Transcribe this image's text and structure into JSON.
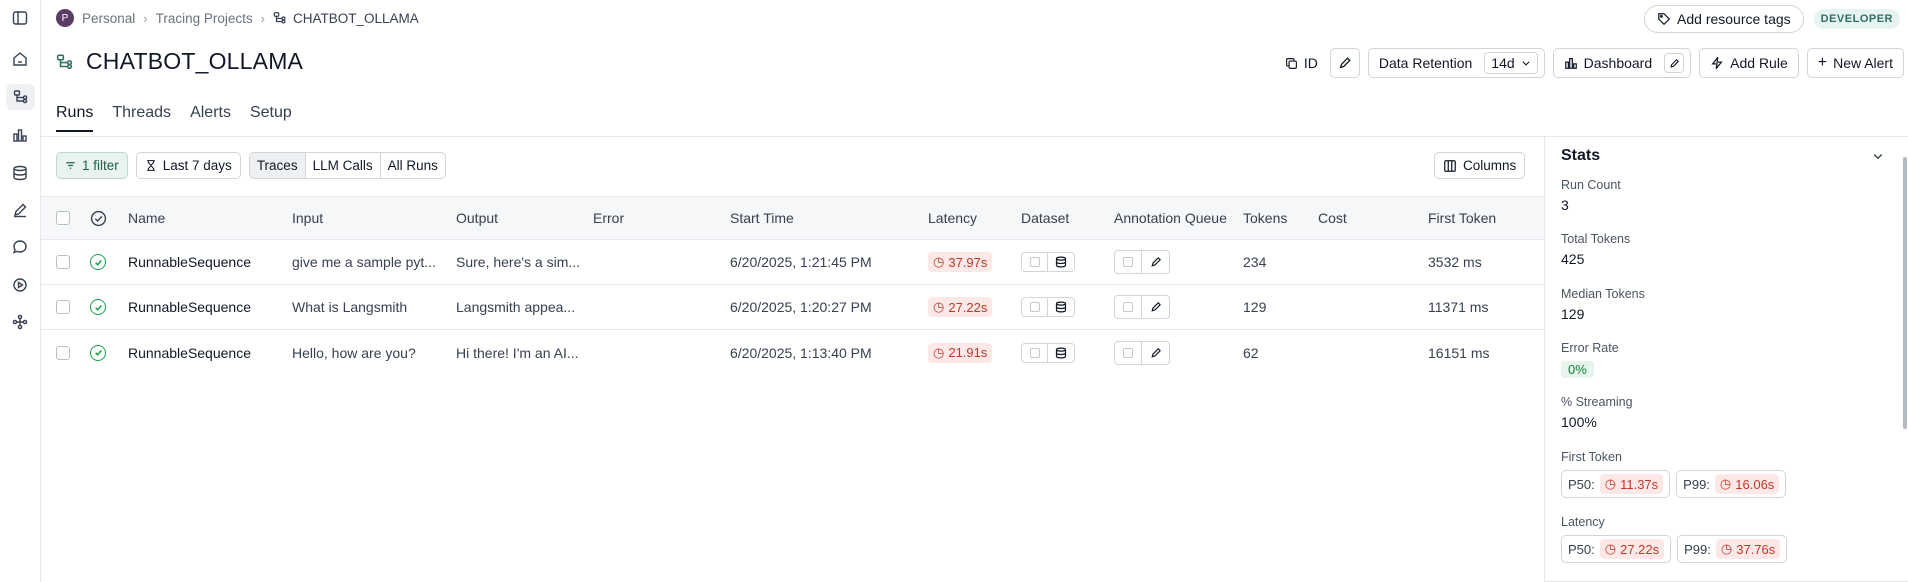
{
  "breadcrumb": {
    "avatar_initial": "P",
    "personal": "Personal",
    "projects": "Tracing Projects",
    "current": "CHATBOT_OLLAMA"
  },
  "top": {
    "resource_tags": "Add resource tags",
    "badge": "DEVELOPER"
  },
  "project": {
    "title": "CHATBOT_OLLAMA",
    "id_label": "ID",
    "data_retention_label": "Data Retention",
    "data_retention_value": "14d",
    "dashboard_label": "Dashboard",
    "add_rule_label": "Add Rule",
    "new_alert_label": "New Alert"
  },
  "tabs": [
    "Runs",
    "Threads",
    "Alerts",
    "Setup"
  ],
  "filters": {
    "filter_label": "1 filter",
    "time_label": "Last 7 days",
    "segments": [
      "Traces",
      "LLM Calls",
      "All Runs"
    ],
    "columns_label": "Columns"
  },
  "table": {
    "headers": {
      "name": "Name",
      "input": "Input",
      "output": "Output",
      "error": "Error",
      "start_time": "Start Time",
      "latency": "Latency",
      "dataset": "Dataset",
      "annotation_queue": "Annotation Queue",
      "tokens": "Tokens",
      "cost": "Cost",
      "first_token": "First Token"
    },
    "rows": [
      {
        "name": "RunnableSequence",
        "input": "give me a sample pyt...",
        "output": "Sure, here's a sim...",
        "error": "",
        "start_time": "6/20/2025, 1:21:45 PM",
        "latency": "37.97s",
        "tokens": "234",
        "cost": "",
        "first_token": "3532 ms"
      },
      {
        "name": "RunnableSequence",
        "input": "What is Langsmith",
        "output": "Langsmith appea...",
        "error": "",
        "start_time": "6/20/2025, 1:20:27 PM",
        "latency": "27.22s",
        "tokens": "129",
        "cost": "",
        "first_token": "11371 ms"
      },
      {
        "name": "RunnableSequence",
        "input": "Hello, how are you?",
        "output": "Hi there! I'm an AI...",
        "error": "",
        "start_time": "6/20/2025, 1:13:40 PM",
        "latency": "21.91s",
        "tokens": "62",
        "cost": "",
        "first_token": "16151 ms"
      }
    ]
  },
  "stats": {
    "title": "Stats",
    "run_count_label": "Run Count",
    "run_count": "3",
    "total_tokens_label": "Total Tokens",
    "total_tokens": "425",
    "median_tokens_label": "Median Tokens",
    "median_tokens": "129",
    "error_rate_label": "Error Rate",
    "error_rate": "0%",
    "streaming_label": "% Streaming",
    "streaming": "100%",
    "first_token_label": "First Token",
    "first_token_p50_label": "P50:",
    "first_token_p50": "11.37s",
    "first_token_p99_label": "P99:",
    "first_token_p99": "16.06s",
    "latency_label": "Latency",
    "latency_p50_label": "P50:",
    "latency_p50": "27.22s",
    "latency_p99_label": "P99:",
    "latency_p99": "37.76s"
  },
  "colors": {
    "latency_bg": "#fde8e8",
    "latency_text": "#c0392b",
    "success": "#16a34a",
    "filter_green": "#e8f3ef"
  }
}
